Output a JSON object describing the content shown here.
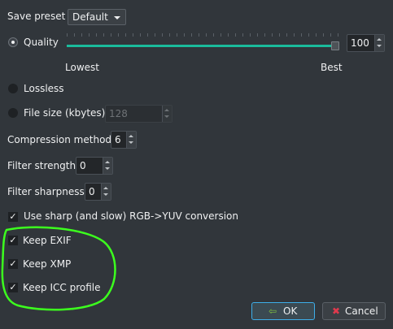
{
  "save_preset": {
    "label": "Save preset",
    "value": "Default"
  },
  "quality": {
    "label": "Quality",
    "value": "100",
    "level": 1.0,
    "min_label": "Lowest",
    "max_label": "Best"
  },
  "lossless": {
    "label": "Lossless"
  },
  "file_size": {
    "label": "File size (kbytes)",
    "value": "128"
  },
  "compression_method": {
    "label": "Compression method",
    "value": "6"
  },
  "filter_strength": {
    "label": "Filter strength",
    "value": "0"
  },
  "filter_sharpness": {
    "label": "Filter sharpness",
    "value": "0"
  },
  "checks": [
    {
      "label": "Use sharp (and slow) RGB->YUV conversion",
      "checked": true
    },
    {
      "label": "Keep EXIF",
      "checked": true
    },
    {
      "label": "Keep XMP",
      "checked": true
    },
    {
      "label": "Keep ICC profile",
      "checked": true
    }
  ],
  "check_mark": "✓",
  "buttons": {
    "ok": "OK",
    "cancel": "Cancel",
    "ok_icon": "⇦",
    "cancel_icon": "✖"
  },
  "colors": {
    "accent": "#1abc9c",
    "annotation": "#3cff1e",
    "cancel_icon": "#e0394d"
  }
}
